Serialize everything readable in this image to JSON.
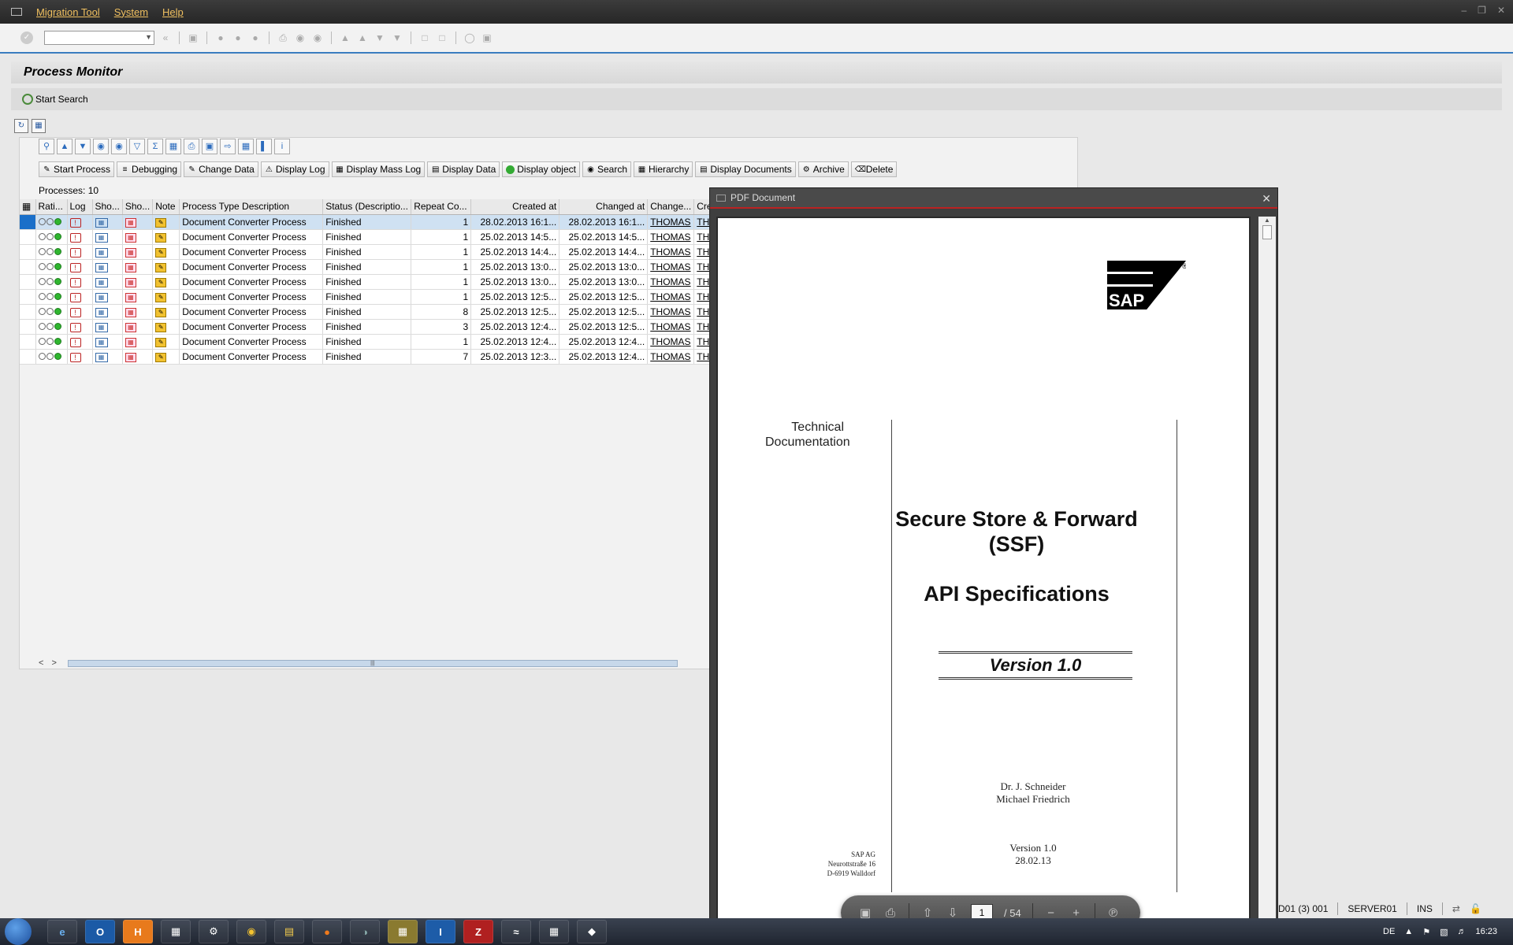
{
  "menubar": {
    "items": [
      "Migration Tool",
      "System",
      "Help"
    ]
  },
  "page": {
    "title": "Process Monitor",
    "start_search": "Start Search"
  },
  "alv": {
    "buttons": [
      "Start Process",
      "Debugging",
      "Change Data",
      "Display Log",
      "Display Mass Log",
      "Display  Data",
      "Display object",
      "Search",
      "Hierarchy",
      "Display Documents",
      "Archive",
      "Delete"
    ],
    "process_count": "Processes: 10",
    "columns": [
      "Rati...",
      "Log",
      "Sho...",
      "Sho...",
      "Note",
      "Process Type Description",
      "Status (Descriptio...",
      "Repeat Co...",
      "Created at",
      "Changed at",
      "Change...",
      "Crea"
    ],
    "rows": [
      {
        "desc": "Document Converter Process",
        "status": "Finished",
        "repeat": "1",
        "created": "28.02.2013 16:1...",
        "changed": "28.02.2013 16:1...",
        "changer": "THOMAS",
        "creator": "THO"
      },
      {
        "desc": "Document Converter Process",
        "status": "Finished",
        "repeat": "1",
        "created": "25.02.2013 14:5...",
        "changed": "25.02.2013 14:5...",
        "changer": "THOMAS",
        "creator": "THO"
      },
      {
        "desc": "Document Converter Process",
        "status": "Finished",
        "repeat": "1",
        "created": "25.02.2013 14:4...",
        "changed": "25.02.2013 14:4...",
        "changer": "THOMAS",
        "creator": "THO"
      },
      {
        "desc": "Document Converter Process",
        "status": "Finished",
        "repeat": "1",
        "created": "25.02.2013 13:0...",
        "changed": "25.02.2013 13:0...",
        "changer": "THOMAS",
        "creator": "THO"
      },
      {
        "desc": "Document Converter Process",
        "status": "Finished",
        "repeat": "1",
        "created": "25.02.2013 13:0...",
        "changed": "25.02.2013 13:0...",
        "changer": "THOMAS",
        "creator": "THO"
      },
      {
        "desc": "Document Converter Process",
        "status": "Finished",
        "repeat": "1",
        "created": "25.02.2013 12:5...",
        "changed": "25.02.2013 12:5...",
        "changer": "THOMAS",
        "creator": "THO"
      },
      {
        "desc": "Document Converter Process",
        "status": "Finished",
        "repeat": "8",
        "created": "25.02.2013 12:5...",
        "changed": "25.02.2013 12:5...",
        "changer": "THOMAS",
        "creator": "THO"
      },
      {
        "desc": "Document Converter Process",
        "status": "Finished",
        "repeat": "3",
        "created": "25.02.2013 12:4...",
        "changed": "25.02.2013 12:5...",
        "changer": "THOMAS",
        "creator": "THO"
      },
      {
        "desc": "Document Converter Process",
        "status": "Finished",
        "repeat": "1",
        "created": "25.02.2013 12:4...",
        "changed": "25.02.2013 12:4...",
        "changer": "THOMAS",
        "creator": "THO"
      },
      {
        "desc": "Document Converter Process",
        "status": "Finished",
        "repeat": "7",
        "created": "25.02.2013 12:3...",
        "changed": "25.02.2013 12:4...",
        "changer": "THOMAS",
        "creator": "THO"
      }
    ]
  },
  "pdf": {
    "window_title": "PDF Document",
    "logo_text": "SAP",
    "tech_doc": "Technical Documentation",
    "title1": "Secure Store & Forward (SSF)",
    "title2": "API Specifications",
    "version_box": "Version 1.0",
    "authors": [
      "Dr. J. Schneider",
      "Michael Friedrich"
    ],
    "version_line": "Version 1.0",
    "date_line": "28.02.13",
    "address": [
      "SAP AG",
      "Neurottstraße 16",
      "D-6919 Walldorf"
    ],
    "current_page": "1",
    "total_pages": "/ 54"
  },
  "statusbar": {
    "session": "D01 (3) 001",
    "server": "SERVER01",
    "mode": "INS"
  },
  "taskbar": {
    "lang": "DE",
    "time": "16:23"
  },
  "colors": {
    "accent": "#3a7dbf",
    "menu_text": "#f0c060",
    "selection": "#1a6fc9"
  }
}
